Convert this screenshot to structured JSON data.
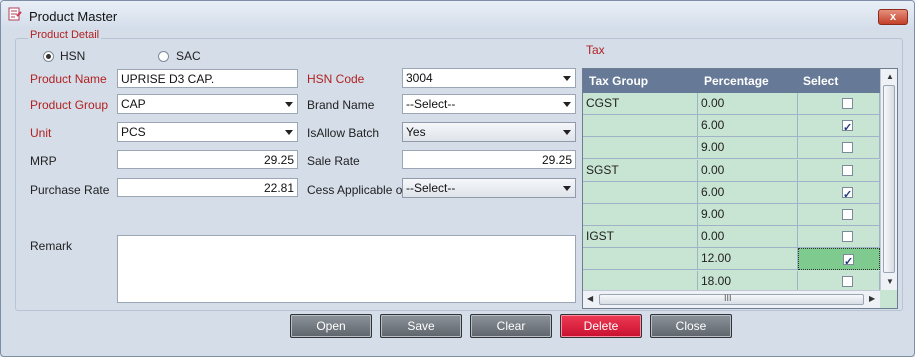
{
  "window": {
    "title": "Product Master",
    "close_label": "x"
  },
  "product_detail": {
    "legend": "Product Detail",
    "radio_hsn": {
      "label": "HSN",
      "selected": true
    },
    "radio_sac": {
      "label": "SAC",
      "selected": false
    },
    "product_name": {
      "label": "Product Name",
      "value": "UPRISE D3 CAP."
    },
    "product_group": {
      "label": "Product Group",
      "value": "CAP"
    },
    "unit": {
      "label": "Unit",
      "value": "PCS"
    },
    "mrp": {
      "label": "MRP",
      "value": "29.25"
    },
    "purchase_rate": {
      "label": "Purchase Rate",
      "value": "22.81"
    },
    "hsn_code": {
      "label": "HSN Code",
      "value": "3004"
    },
    "brand_name": {
      "label": "Brand Name",
      "value": "--Select--"
    },
    "is_allow_batch": {
      "label": "IsAllow Batch",
      "value": "Yes"
    },
    "sale_rate": {
      "label": "Sale Rate",
      "value": "29.25"
    },
    "cess_applicable_on": {
      "label": "Cess Applicable on",
      "value": "--Select--"
    },
    "remark": {
      "label": "Remark",
      "value": ""
    }
  },
  "tax": {
    "label": "Tax",
    "columns": [
      "Tax Group",
      "Percentage",
      "Select"
    ],
    "rows": [
      {
        "group": "CGST",
        "percentage": "0.00",
        "selected": false
      },
      {
        "group": "",
        "percentage": "6.00",
        "selected": true
      },
      {
        "group": "",
        "percentage": "9.00",
        "selected": false
      },
      {
        "group": "SGST",
        "percentage": "0.00",
        "selected": false
      },
      {
        "group": "",
        "percentage": "6.00",
        "selected": true
      },
      {
        "group": "",
        "percentage": "9.00",
        "selected": false
      },
      {
        "group": "IGST",
        "percentage": "0.00",
        "selected": false
      },
      {
        "group": "",
        "percentage": "12.00",
        "selected": true
      },
      {
        "group": "",
        "percentage": "18.00",
        "selected": false
      }
    ],
    "scroll_grip": "III"
  },
  "buttons": {
    "open": "Open",
    "save": "Save",
    "clear": "Clear",
    "delete": "Delete",
    "close": "Close"
  },
  "colors": {
    "delete_button": "#c8102e",
    "label_accent": "#b22222",
    "grid_background": "#c8e4d2",
    "grid_header": "#667a97"
  }
}
